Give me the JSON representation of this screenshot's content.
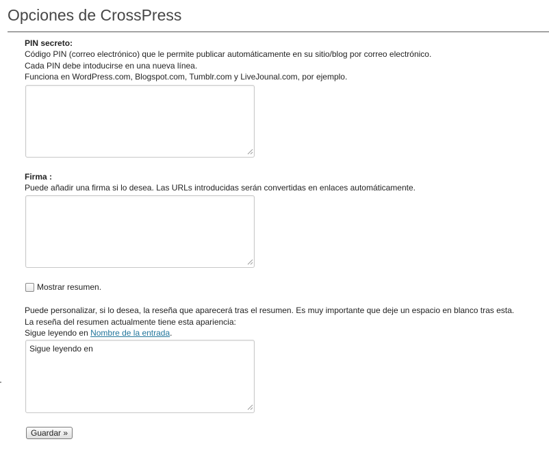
{
  "page": {
    "title": "Opciones de CrossPress"
  },
  "pin_section": {
    "label": "PIN secreto:",
    "desc_lines": [
      "Código PIN (correo electrónico) que le permite publicar automáticamente en su sitio/blog por correo electrónico.",
      "Cada PIN debe intoducirse en una nueva línea.",
      "Funciona en WordPress.com, Blogspot.com, Tumblr.com y LiveJounal.com, por ejemplo."
    ],
    "value": ""
  },
  "signature_section": {
    "label": "Firma :",
    "desc": "Puede añadir una firma si lo desea. Las URLs introducidas serán convertidas en enlaces automáticamente.",
    "value": ""
  },
  "summary_checkbox": {
    "label": "Mostrar resumen.",
    "checked": false
  },
  "readmore_section": {
    "desc_lines": [
      "Puede personalizar, si lo desea, la reseña que aparecerá tras el resumen. Es muy importante que deje un espacio en blanco tras esta.",
      "La reseña del resumen actualmente tiene esta apariencia:"
    ],
    "preview_prefix": "Sigue leyendo en ",
    "preview_link": "Nombre de la entrada",
    "preview_suffix": ".",
    "value": "Sigue leyendo en"
  },
  "save_button": {
    "label": "Guardar »"
  },
  "colors": {
    "link": "#21759b",
    "title": "#464646"
  }
}
